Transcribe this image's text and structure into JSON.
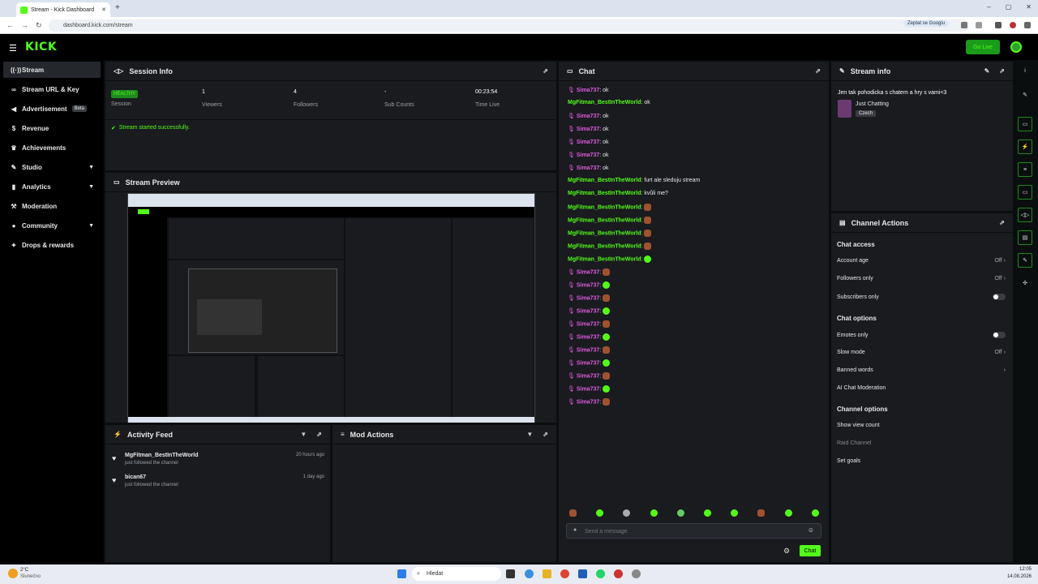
{
  "browser": {
    "tab_title": "Stream - Kick Dashboard",
    "url": "dashboard.kick.com/stream",
    "search_hint": "Zeptat se Googlu"
  },
  "topbar": {
    "logo": "KICK",
    "go_live": "Go Live"
  },
  "sidebar": {
    "items": [
      {
        "label": "Stream",
        "icon": "radio-icon"
      },
      {
        "label": "Stream URL & Key",
        "icon": "link-icon"
      },
      {
        "label": "Advertisement",
        "icon": "megaphone-icon",
        "badge": "Beta"
      },
      {
        "label": "Revenue",
        "icon": "dollar-icon"
      },
      {
        "label": "Achievements",
        "icon": "trophy-icon"
      },
      {
        "label": "Studio",
        "icon": "studio-icon"
      },
      {
        "label": "Analytics",
        "icon": "chart-icon"
      },
      {
        "label": "Moderation",
        "icon": "hammer-icon"
      },
      {
        "label": "Community",
        "icon": "users-icon"
      },
      {
        "label": "Drops & rewards",
        "icon": "gift-icon"
      }
    ]
  },
  "session": {
    "title": "Session Info",
    "status": "HEALTHY",
    "status_label": "Session",
    "viewers": "1",
    "viewers_label": "Viewers",
    "followers": "4",
    "followers_label": "Followers",
    "subs": "-",
    "subs_label": "Sub Counts",
    "time": "00:23:54",
    "time_label": "Time Live",
    "message": "Stream started successfully."
  },
  "preview": {
    "title": "Stream Preview"
  },
  "activity": {
    "title": "Activity Feed",
    "items": [
      {
        "user": "MgFitman_BestInTheWorld",
        "action": "just followed the channel",
        "time": "20 hours ago"
      },
      {
        "user": "bican67",
        "action": "just followed the channel",
        "time": "1 day ago"
      }
    ]
  },
  "mod_actions": {
    "title": "Mod Actions"
  },
  "chat": {
    "title": "Chat",
    "placeholder": "Send a message",
    "send_label": "Chat",
    "messages": [
      {
        "user": "Sima737",
        "text": "ok"
      },
      {
        "user": "MgFitman_BestInTheWorld",
        "text": "ok"
      },
      {
        "user": "Sima737",
        "text": "ok"
      },
      {
        "user": "Sima737",
        "text": "ok"
      },
      {
        "user": "Sima737",
        "text": "ok"
      },
      {
        "user": "Sima737",
        "text": "ok"
      },
      {
        "user": "Sima737",
        "text": "ok"
      },
      {
        "user": "MgFitman_BestInTheWorld",
        "text": "furt ale sleduju stream"
      },
      {
        "user": "MgFitman_BestInTheWorld",
        "text": "kvůli me?"
      }
    ]
  },
  "stream_info": {
    "title": "Stream info",
    "stream_title": "Jen tak pohodicka s chatem a hry s vami<3",
    "category": "Just Chatting",
    "language": "Czech"
  },
  "channel_actions": {
    "title": "Channel Actions",
    "chat_access": "Chat access",
    "account_age": "Account age",
    "account_age_value": "Off",
    "followers_only": "Followers only",
    "followers_only_value": "Off",
    "subscribers_only": "Subscribers only",
    "chat_options": "Chat options",
    "emotes_only": "Emotes only",
    "slow_mode": "Slow mode",
    "slow_mode_value": "Off",
    "banned_words": "Banned words",
    "ai_moderation": "AI Chat Moderation",
    "channel_options": "Channel options",
    "show_view_count": "Show view count",
    "raid_channel": "Raid Channel",
    "set_goals": "Set goals"
  },
  "taskbar": {
    "weather": "2°C",
    "weather_desc": "Slunečno",
    "search": "Hledat",
    "time": "12:05",
    "date": "14.08.2026"
  },
  "colors": {
    "accent": "#53fc18",
    "panel": "#191b1f",
    "bg": "#0b0e0f",
    "user_pink": "#e05be0"
  }
}
